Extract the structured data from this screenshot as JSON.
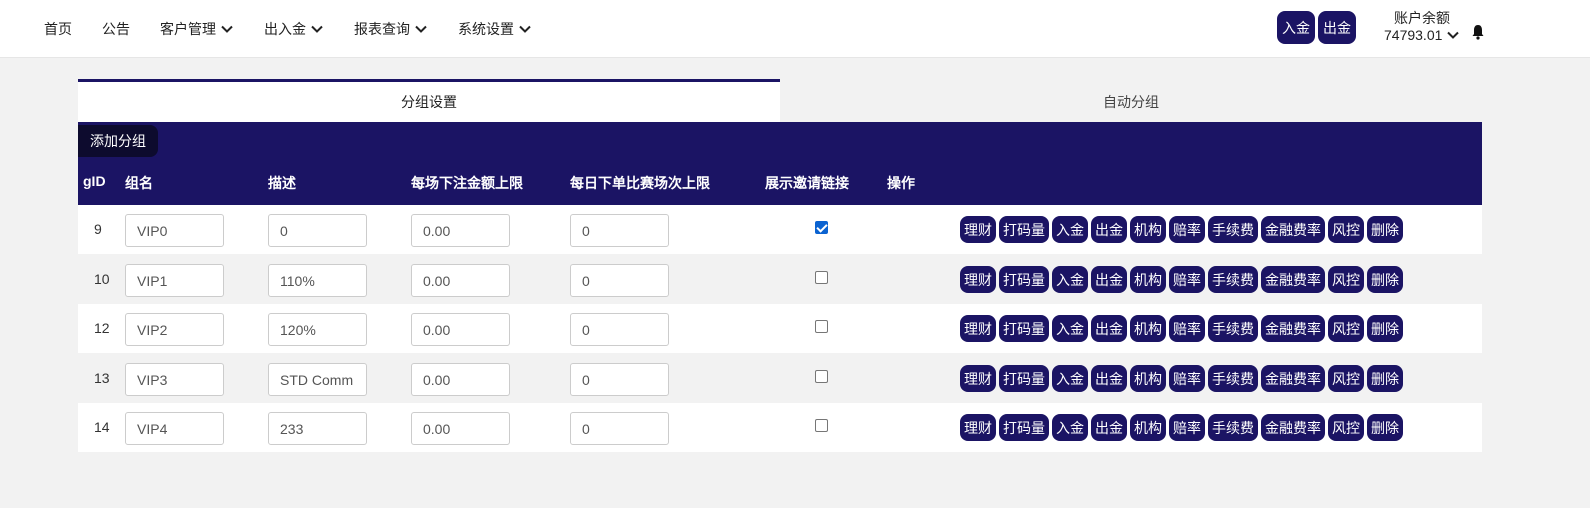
{
  "nav": {
    "home": "首页",
    "notice": "公告",
    "customer": "客户管理",
    "inout": "出入金",
    "reports": "报表查询",
    "settings": "系统设置"
  },
  "header": {
    "deposit": "入金",
    "withdraw": "出金",
    "balance_label": "账户余额",
    "balance_value": "74793.01"
  },
  "tabs": {
    "group_settings": "分组设置",
    "auto_group": "自动分组"
  },
  "table": {
    "add_button": "添加分组",
    "columns": {
      "gid": "gID",
      "name": "组名",
      "desc": "描述",
      "bet_limit": "每场下注金额上限",
      "daily_limit": "每日下单比赛场次上限",
      "invite": "展示邀请链接",
      "ops": "操作"
    },
    "rows": [
      {
        "gid": "9",
        "name": "VIP0",
        "desc": "0",
        "bet_limit": "0.00",
        "daily_limit": "0",
        "invite": true
      },
      {
        "gid": "10",
        "name": "VIP1",
        "desc": "110%",
        "bet_limit": "0.00",
        "daily_limit": "0",
        "invite": false
      },
      {
        "gid": "12",
        "name": "VIP2",
        "desc": "120%",
        "bet_limit": "0.00",
        "daily_limit": "0",
        "invite": false
      },
      {
        "gid": "13",
        "name": "VIP3",
        "desc": "STD Comm",
        "bet_limit": "0.00",
        "daily_limit": "0",
        "invite": false
      },
      {
        "gid": "14",
        "name": "VIP4",
        "desc": "233",
        "bet_limit": "0.00",
        "daily_limit": "0",
        "invite": false
      }
    ],
    "actions": [
      "理财",
      "打码量",
      "入金",
      "出金",
      "机构",
      "赔率",
      "手续费",
      "金融费率",
      "风控",
      "删除"
    ]
  },
  "colors": {
    "primary": "#1b1464",
    "checkbox_on": "#0b63d1",
    "background": "#f2f2f2"
  }
}
